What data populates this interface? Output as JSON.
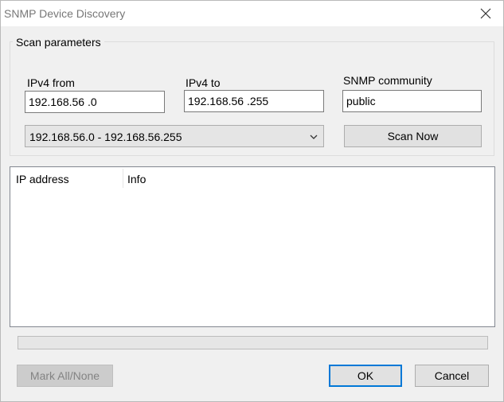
{
  "window": {
    "title": "SNMP Device Discovery"
  },
  "scan": {
    "group_label": "Scan parameters",
    "ipv4_from_label": "IPv4 from",
    "ipv4_from_value": "192.168.56 .0",
    "ipv4_to_label": "IPv4 to",
    "ipv4_to_value": "192.168.56 .255",
    "community_label": "SNMP community",
    "community_value": "public",
    "range_selected": "192.168.56.0 - 192.168.56.255",
    "scan_button": "Scan Now"
  },
  "results": {
    "columns": [
      "IP address",
      "Info"
    ],
    "rows": []
  },
  "progress": {
    "value": 0
  },
  "footer": {
    "mark_all_button": "Mark All/None",
    "ok_button": "OK",
    "cancel_button": "Cancel"
  },
  "icons": {
    "close": "close-icon",
    "dropdown": "chevron-down-icon"
  },
  "colors": {
    "accent": "#0078d7",
    "title_text": "#777777",
    "disabled_text": "#838383"
  }
}
